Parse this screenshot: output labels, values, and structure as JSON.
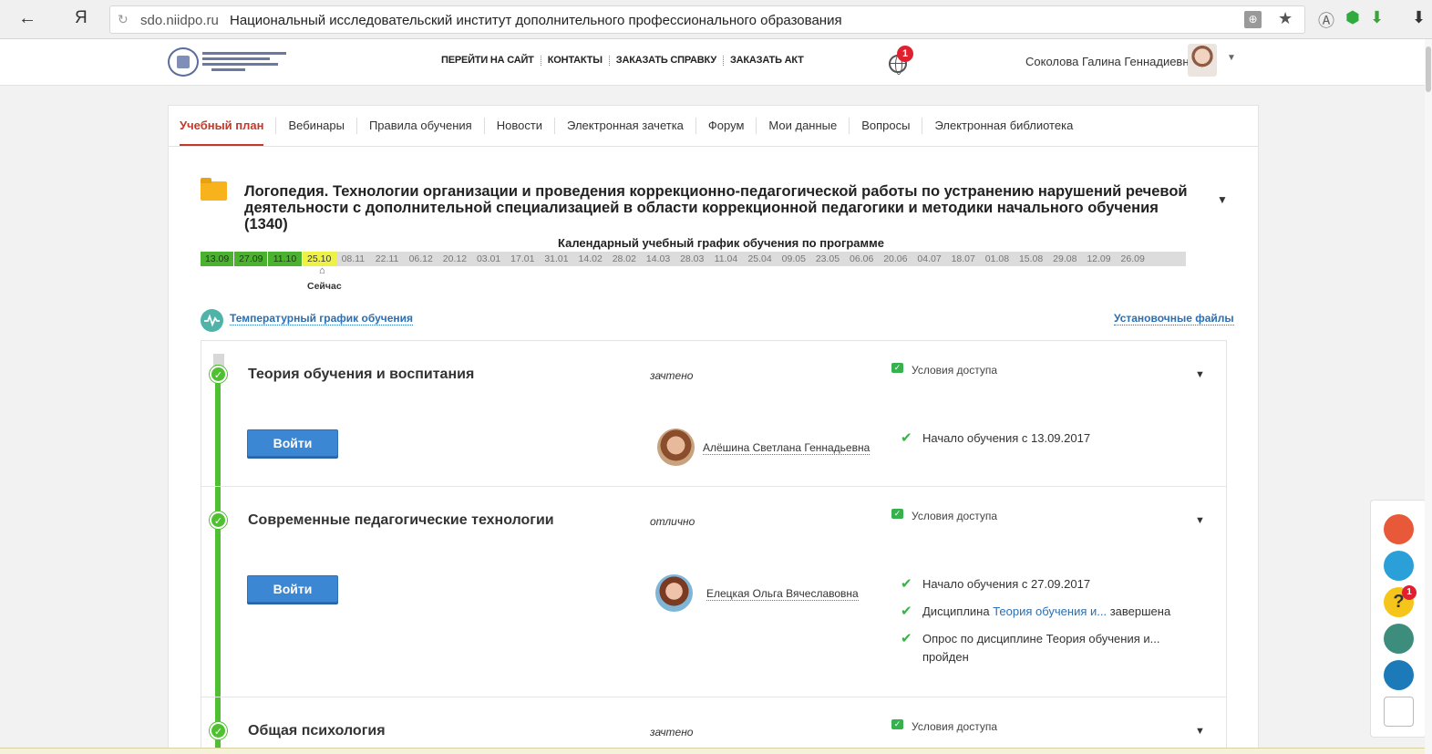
{
  "browser": {
    "back": "←",
    "yandex": "Я",
    "domain": "sdo.niidpo.ru",
    "page_title": "Национальный исследовательский институт дополнительного профессионального образования",
    "reload": "↻",
    "star": "★",
    "download": "⬇",
    "ext_a": "Ⓐ",
    "shield": "⬢",
    "down": "⬇"
  },
  "header": {
    "nav": [
      "ПЕРЕЙТИ НА САЙТ",
      "КОНТАКТЫ",
      "ЗАКАЗАТЬ СПРАВКУ",
      "ЗАКАЗАТЬ АКТ"
    ],
    "notifications": "1",
    "user_name": "Соколова Галина Геннадиевна",
    "caret": "▼"
  },
  "tabs": [
    "Учебный план",
    "Вебинары",
    "Правила обучения",
    "Новости",
    "Электронная зачетка",
    "Форум",
    "Мои данные",
    "Вопросы",
    "Электронная библиотека"
  ],
  "program": {
    "title": "Логопедия. Технологии организации и проведения коррекционно-педагогической работы по устранению нарушений речевой деятельности с дополнительной специализацией в области коррекционной педагогики и методики начального обучения (1340)",
    "caret": "▼"
  },
  "calendar": {
    "title": "Календарный учебный график обучения по программе",
    "dates": [
      "13.09",
      "27.09",
      "11.10",
      "25.10",
      "08.11",
      "22.11",
      "06.12",
      "20.12",
      "03.01",
      "17.01",
      "31.01",
      "14.02",
      "28.02",
      "14.03",
      "28.03",
      "11.04",
      "25.04",
      "09.05",
      "23.05",
      "06.06",
      "20.06",
      "04.07",
      "18.07",
      "01.08",
      "15.08",
      "29.08",
      "12.09",
      "26.09"
    ],
    "completed_count": 3,
    "current_index": 3,
    "now_marker": "⌂",
    "now_label": "Сейчас"
  },
  "links": {
    "temperature": "Температурный график обучения",
    "setup_files": "Установочные файлы"
  },
  "courses": [
    {
      "title": "Теория обучения и воспитания",
      "grade": "зачтено",
      "access": "Условия доступа",
      "button": "Войти",
      "teacher": "Алёшина Светлана Геннадьевна",
      "conditions": [
        {
          "text": "Начало обучения с 13.09.2017"
        }
      ]
    },
    {
      "title": "Современные педагогические технологии",
      "grade": "отлично",
      "access": "Условия доступа",
      "button": "Войти",
      "teacher": "Елецкая Ольга Вячеславовна",
      "conditions": [
        {
          "text": "Начало обучения с 27.09.2017"
        },
        {
          "prefix": "Дисциплина ",
          "link": "Теория обучения и...",
          "suffix": " завершена"
        },
        {
          "text": "Опрос по дисциплине Теория обучения и... пройден"
        }
      ]
    },
    {
      "title": "Общая психология",
      "grade": "зачтено",
      "access": "Условия доступа"
    }
  ],
  "side_panel": {
    "help_badge": "1",
    "help_icon": "?"
  },
  "glyphs": {
    "check": "✔",
    "tick": "✓",
    "caret": "▼"
  }
}
